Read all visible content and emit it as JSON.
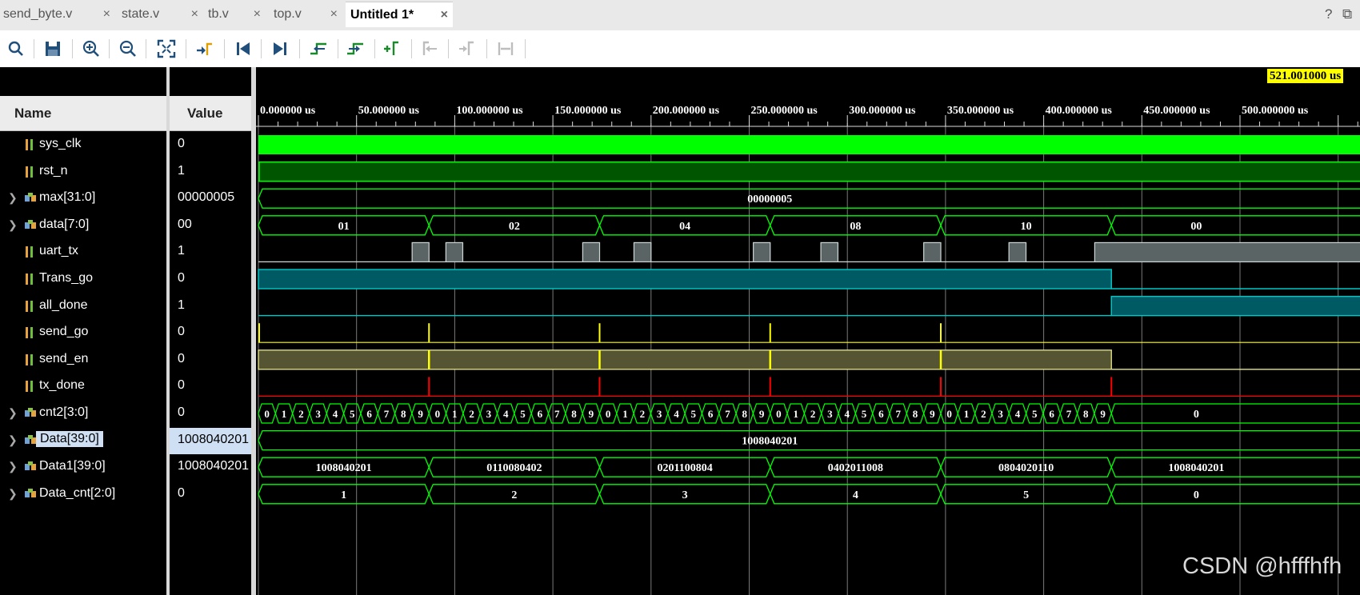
{
  "tabs": [
    {
      "label": "send_byte.v"
    },
    {
      "label": "state.v"
    },
    {
      "label": "tb.v"
    },
    {
      "label": "top.v"
    },
    {
      "label": "Untitled 1*"
    }
  ],
  "tab_close": "×",
  "corner": {
    "help": "?",
    "restore": "⧉"
  },
  "toolbar": {
    "buttons": [
      "search-icon",
      "save-icon",
      "zoom-in-icon",
      "zoom-out-icon",
      "zoom-fit-icon",
      "go-to-cursor-icon",
      "go-to-time-0-icon",
      "go-to-last-time-icon",
      "previous-transition-icon",
      "next-transition-icon",
      "add-marker-icon",
      "previous-marker-icon",
      "next-marker-icon",
      "swap-cursors-icon"
    ]
  },
  "headers": {
    "name": "Name",
    "value": "Value"
  },
  "cursor_time": "521.001000 us",
  "watermark": "CSDN @hfffhfh",
  "colors": {
    "green": "#00ff00",
    "dark_green": "#005500",
    "cyan": "#00c8c8",
    "teal_fill": "#005a64",
    "yellow": "#ffff00",
    "yellow_fill": "#555533",
    "red": "#ff0000",
    "gray_fill": "#5a6464",
    "grid": "#7a7a7a",
    "selection": "#cfe0f4"
  },
  "timeline": {
    "start_us": 0,
    "end_us": 521.001,
    "major_step_us": 50,
    "labels": [
      "0.000000 us",
      "50.000000 us",
      "100.000000 us",
      "150.000000 us",
      "200.000000 us",
      "250.000000 us",
      "300.000000 us",
      "350.000000 us",
      "400.000000 us",
      "450.000000 us",
      "500.000000 us"
    ]
  },
  "signals": [
    {
      "name": "sys_clk",
      "value": "0",
      "icon": "scalar-signal-icon",
      "expandable": false
    },
    {
      "name": "rst_n",
      "value": "1",
      "icon": "scalar-signal-icon",
      "expandable": false
    },
    {
      "name": "max[31:0]",
      "value": "00000005",
      "icon": "bus-signal-icon",
      "expandable": true
    },
    {
      "name": "data[7:0]",
      "value": "00",
      "icon": "bus-signal-icon",
      "expandable": true
    },
    {
      "name": "uart_tx",
      "value": "1",
      "icon": "scalar-signal-icon",
      "expandable": false
    },
    {
      "name": "Trans_go",
      "value": "0",
      "icon": "scalar-signal-icon",
      "expandable": false
    },
    {
      "name": "all_done",
      "value": "1",
      "icon": "scalar-signal-icon",
      "expandable": false
    },
    {
      "name": "send_go",
      "value": "0",
      "icon": "scalar-signal-icon",
      "expandable": false
    },
    {
      "name": "send_en",
      "value": "0",
      "icon": "scalar-signal-icon",
      "expandable": false
    },
    {
      "name": "tx_done",
      "value": "0",
      "icon": "scalar-signal-icon",
      "expandable": false
    },
    {
      "name": "cnt2[3:0]",
      "value": "0",
      "icon": "bus-signal-icon",
      "expandable": true
    },
    {
      "name": "Data[39:0]",
      "value": "1008040201",
      "icon": "bus-signal-icon",
      "expandable": true,
      "selected": true
    },
    {
      "name": "Data1[39:0]",
      "value": "1008040201",
      "icon": "bus-signal-icon",
      "expandable": true
    },
    {
      "name": "Data_cnt[2:0]",
      "value": "0",
      "icon": "bus-signal-icon",
      "expandable": true
    }
  ],
  "waves": {
    "sys_clk": {
      "kind": "clock"
    },
    "rst_n": {
      "kind": "level_high",
      "from_us": 0.4
    },
    "max": {
      "kind": "bus",
      "segments": [
        {
          "from_us": 0,
          "to_us": 521,
          "label": "00000005"
        }
      ]
    },
    "data": {
      "kind": "bus",
      "segments": [
        {
          "from_us": 0,
          "to_us": 86.9,
          "label": "01"
        },
        {
          "from_us": 86.9,
          "to_us": 173.8,
          "label": "02"
        },
        {
          "from_us": 173.8,
          "to_us": 260.7,
          "label": "04"
        },
        {
          "from_us": 260.7,
          "to_us": 347.6,
          "label": "08"
        },
        {
          "from_us": 347.6,
          "to_us": 434.5,
          "label": "10"
        },
        {
          "from_us": 434.5,
          "to_us": 521,
          "label": "00"
        }
      ]
    },
    "uart_tx": {
      "kind": "pulses",
      "pulses": [
        [
          78.3,
          86.9
        ],
        [
          95.5,
          104.1
        ],
        [
          165.2,
          173.8
        ],
        [
          191.3,
          200
        ],
        [
          252.1,
          260.7
        ],
        [
          286.5,
          295.2
        ],
        [
          338.9,
          347.6
        ],
        [
          382.3,
          391
        ],
        [
          426,
          521
        ]
      ]
    },
    "Trans_go": {
      "kind": "high_until",
      "to_us": 434.5
    },
    "all_done": {
      "kind": "high_from",
      "from_us": 434.5
    },
    "send_go": {
      "kind": "spikes",
      "at_us": [
        0.4,
        86.9,
        173.8,
        260.7,
        347.6
      ]
    },
    "send_en": {
      "kind": "high_until_with_spikes",
      "to_us": 434.5,
      "spikes_us": [
        86.9,
        173.8,
        260.7,
        347.6
      ]
    },
    "tx_done": {
      "kind": "spikes",
      "at_us": [
        86.9,
        173.8,
        260.7,
        347.6,
        434.5
      ]
    },
    "cnt2": {
      "kind": "counter",
      "period_us": 86.9,
      "count": 10,
      "blocks": 5,
      "tail_label": "0"
    },
    "Data": {
      "kind": "bus",
      "segments": [
        {
          "from_us": 0,
          "to_us": 521,
          "label": "1008040201"
        }
      ]
    },
    "Data1": {
      "kind": "bus",
      "segments": [
        {
          "from_us": 0,
          "to_us": 86.9,
          "label": "1008040201"
        },
        {
          "from_us": 86.9,
          "to_us": 173.8,
          "label": "0110080402"
        },
        {
          "from_us": 173.8,
          "to_us": 260.7,
          "label": "0201100804"
        },
        {
          "from_us": 260.7,
          "to_us": 347.6,
          "label": "0402011008"
        },
        {
          "from_us": 347.6,
          "to_us": 434.5,
          "label": "0804020110"
        },
        {
          "from_us": 434.5,
          "to_us": 521,
          "label": "1008040201"
        }
      ]
    },
    "Data_cnt": {
      "kind": "bus",
      "segments": [
        {
          "from_us": 0,
          "to_us": 86.9,
          "label": "1"
        },
        {
          "from_us": 86.9,
          "to_us": 173.8,
          "label": "2"
        },
        {
          "from_us": 173.8,
          "to_us": 260.7,
          "label": "3"
        },
        {
          "from_us": 260.7,
          "to_us": 347.6,
          "label": "4"
        },
        {
          "from_us": 347.6,
          "to_us": 434.5,
          "label": "5"
        },
        {
          "from_us": 434.5,
          "to_us": 521,
          "label": "0"
        }
      ]
    }
  }
}
